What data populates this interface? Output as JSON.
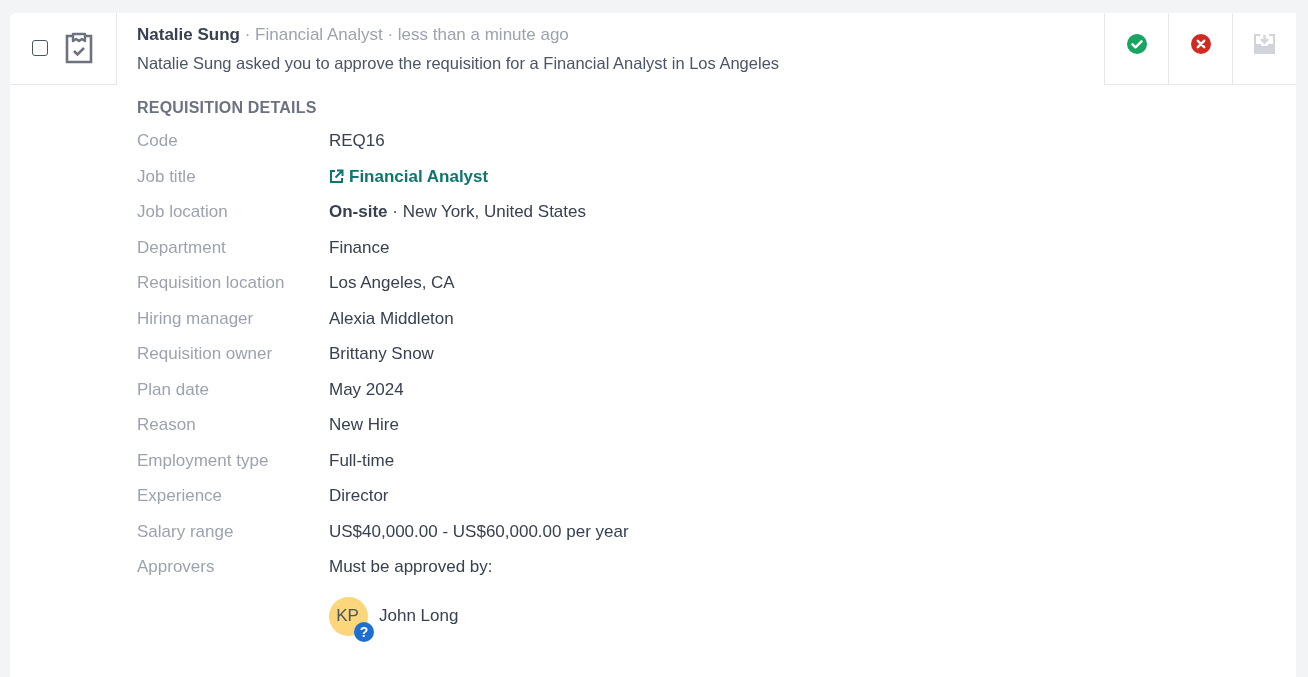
{
  "item": {
    "checked": false,
    "author": "Natalie Sung",
    "meta": "· Financial Analyst · less than a minute ago",
    "description": "Natalie Sung asked you to approve the requisition for a Financial Analyst in Los Angeles"
  },
  "actions": [
    {
      "kind": "approve",
      "disabled": false
    },
    {
      "kind": "reject",
      "disabled": false
    },
    {
      "kind": "archive",
      "disabled": true
    }
  ],
  "details": {
    "heading": "REQUISITION DETAILS",
    "rows": [
      {
        "label": "Code",
        "value": "REQ16",
        "kind": "text"
      },
      {
        "label": "Job title",
        "value": "Financial Analyst",
        "kind": "link"
      },
      {
        "label": "Job location",
        "value": "**On-site** · New York, United States",
        "kind": "text"
      },
      {
        "label": "Department",
        "value": "Finance",
        "kind": "text"
      },
      {
        "label": "Requisition location",
        "value": "Los Angeles, CA",
        "kind": "text"
      },
      {
        "label": "Hiring manager",
        "value": "Alexia Middleton",
        "kind": "text"
      },
      {
        "label": "Requisition owner",
        "value": "Brittany Snow",
        "kind": "text"
      },
      {
        "label": "Plan date",
        "value": "May 2024",
        "kind": "text"
      },
      {
        "label": "Reason",
        "value": "New Hire",
        "kind": "text"
      },
      {
        "label": "Employment type",
        "value": "Full-time",
        "kind": "text"
      },
      {
        "label": "Experience",
        "value": "Director",
        "kind": "text"
      },
      {
        "label": "Salary range",
        "value": "US$40,000.00 - US$60,000.00 per year",
        "kind": "text"
      },
      {
        "label": "Approvers",
        "value": "Must be approved by:",
        "kind": "text"
      }
    ],
    "approvers": [
      {
        "initials": "KP",
        "status": "?",
        "name": "John Long",
        "color": "#fcd67a"
      }
    ]
  }
}
